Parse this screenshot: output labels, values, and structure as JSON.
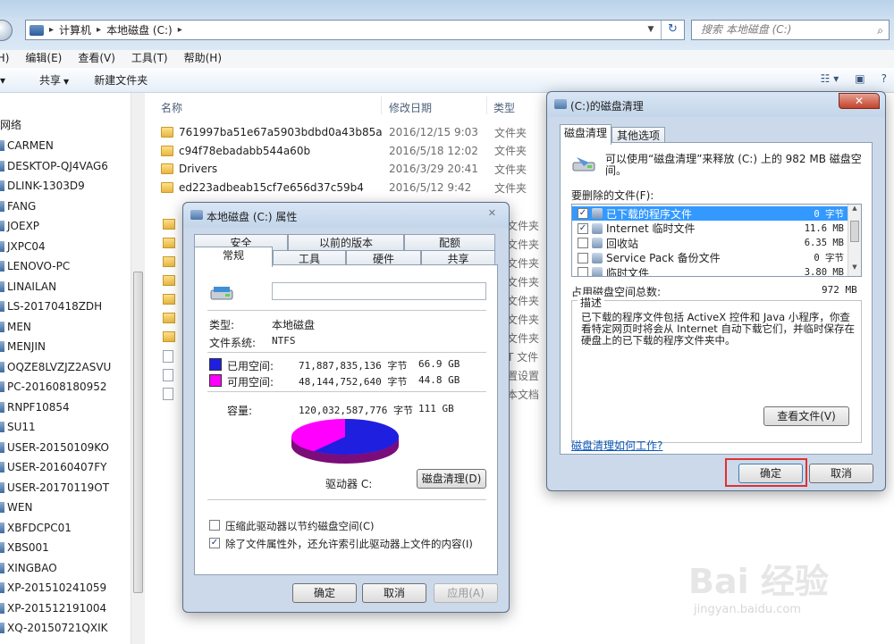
{
  "explorer": {
    "breadcrumb": [
      "计算机",
      "本地磁盘 (C:)"
    ],
    "search_placeholder": "搜索 本地磁盘 (C:)",
    "menu": [
      "(H)",
      "编辑(E)",
      "查看(V)",
      "工具(T)",
      "帮助(H)"
    ],
    "toolbar": [
      "共享",
      "新建文件夹"
    ],
    "nav_title": "网络",
    "nav_items": [
      "CARMEN",
      "DESKTOP-QJ4VAG6",
      "DLINK-1303D9",
      "FANG",
      "JOEXP",
      "JXPC04",
      "LENOVO-PC",
      "LINAILAN",
      "LS-20170418ZDH",
      "MEN",
      "MENJIN",
      "OQZE8LVZJZ2ASVU",
      "PC-201608180952",
      "RNPF10854",
      "SU11",
      "USER-20150109KO",
      "USER-20160407FY",
      "USER-20170119OT",
      "WEN",
      "XBFDCPC01",
      "XBS001",
      "XINGBAO",
      "XP-201510241059",
      "XP-201512191004",
      "XQ-20150721QXIK"
    ],
    "columns": [
      "名称",
      "修改日期",
      "类型"
    ],
    "files": [
      {
        "name": "761997ba51e67a5903bdbd0a43b85a",
        "date": "2016/12/15 9:03",
        "type": "文件夹"
      },
      {
        "name": "c94f78ebadabb544a60b",
        "date": "2016/5/18 12:02",
        "type": "文件夹"
      },
      {
        "name": "Drivers",
        "date": "2016/3/29 20:41",
        "type": "文件夹"
      },
      {
        "name": "ed223adbeab15cf7e656d37c59b4",
        "date": "2016/5/12 9:42",
        "type": "文件夹"
      }
    ],
    "tail_types": [
      "文件夹",
      "文件夹",
      "文件夹",
      "文件夹",
      "文件夹",
      "文件夹",
      "文件夹",
      "T 文件",
      "置设置",
      "本文档"
    ]
  },
  "props": {
    "title": "本地磁盘 (C:) 属性",
    "tabs_top": [
      "安全",
      "以前的版本",
      "配额"
    ],
    "tabs_bottom": [
      "常规",
      "工具",
      "硬件",
      "共享"
    ],
    "type_label": "类型:",
    "type_value": "本地磁盘",
    "fs_label": "文件系统:",
    "fs_value": "NTFS",
    "used_label": "已用空间:",
    "used_bytes": "71,887,835,136 字节",
    "used_gb": "66.9 GB",
    "free_label": "可用空间:",
    "free_bytes": "48,144,752,640 字节",
    "free_gb": "44.8 GB",
    "cap_label": "容量:",
    "cap_bytes": "120,032,587,776 字节",
    "cap_gb": "111 GB",
    "drive_label": "驱动器 C:",
    "cleanup_btn": "磁盘清理(D)",
    "compress_label": "压缩此驱动器以节约磁盘空间(C)",
    "compress_checked": false,
    "index_label": "除了文件属性外，还允许索引此驱动器上文件的内容(I)",
    "index_checked": true,
    "ok": "确定",
    "cancel": "取消",
    "apply": "应用(A)",
    "used_color": "#1f1fe0",
    "free_color": "#ff00ff",
    "used_fraction": 0.599
  },
  "cleanup": {
    "title": "(C:)的磁盘清理",
    "tabs": [
      "磁盘清理",
      "其他选项"
    ],
    "intro": "可以使用“磁盘清理”来释放 (C:) 上的 982 MB 磁盘空间。",
    "files_label": "要删除的文件(F):",
    "items": [
      {
        "label": "已下载的程序文件",
        "size": "0 字节",
        "checked": true,
        "selected": true
      },
      {
        "label": "Internet 临时文件",
        "size": "11.6 MB",
        "checked": true,
        "selected": false
      },
      {
        "label": "回收站",
        "size": "6.35 MB",
        "checked": false,
        "selected": false
      },
      {
        "label": "Service Pack 备份文件",
        "size": "0 字节",
        "checked": false,
        "selected": false
      },
      {
        "label": "临时文件",
        "size": "3.80 MB",
        "checked": false,
        "selected": false
      }
    ],
    "total_label": "占用磁盘空间总数:",
    "total_value": "972 MB",
    "desc_title": "描述",
    "description": "已下载的程序文件包括 ActiveX 控件和 Java 小程序，你查看特定网页时将会从 Internet 自动下载它们，并临时保存在硬盘上的已下载的程序文件夹中。",
    "view_files_btn": "查看文件(V)",
    "how_link": "磁盘清理如何工作?",
    "ok": "确定",
    "cancel": "取消"
  },
  "watermark": {
    "main": "Bai 经验",
    "sub": "jingyan.baidu.com"
  }
}
